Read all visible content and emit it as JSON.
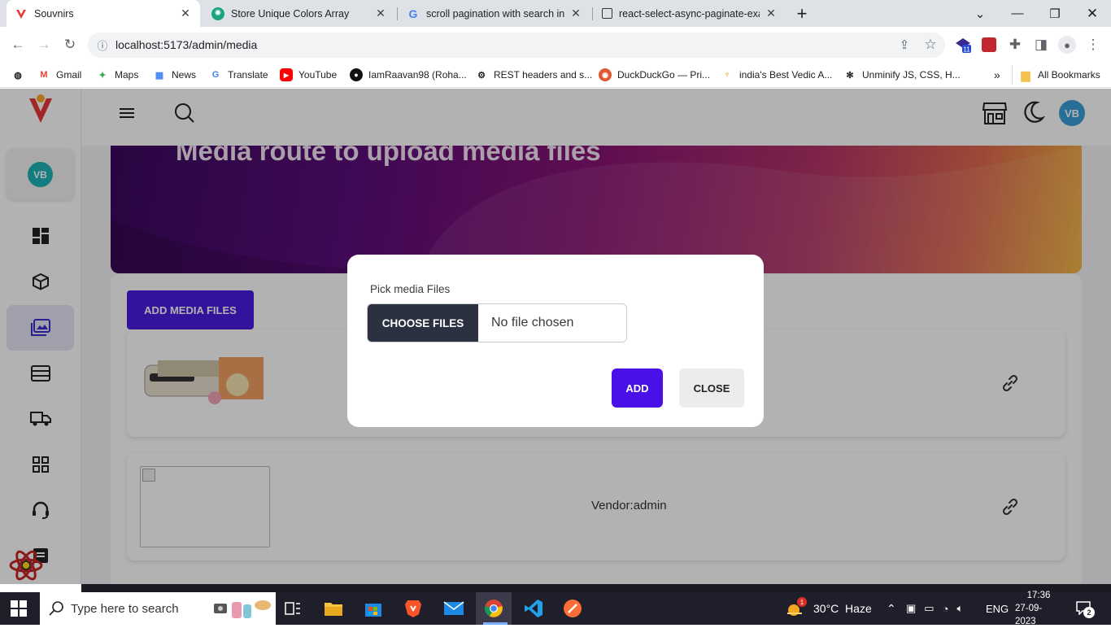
{
  "browser": {
    "tabs": [
      {
        "title": "Souvnirs",
        "active": true
      },
      {
        "title": "Store Unique Colors Array",
        "active": false
      },
      {
        "title": "scroll pagination with search in r",
        "active": false
      },
      {
        "title": "react-select-async-paginate-exa",
        "active": false
      }
    ],
    "new_tab": "+",
    "url": "localhost:5173/admin/media",
    "extension_badge": "11",
    "bookmarks": [
      {
        "label": "Gmail",
        "icon": "gmail-icon"
      },
      {
        "label": "Maps",
        "icon": "maps-icon"
      },
      {
        "label": "News",
        "icon": "news-icon"
      },
      {
        "label": "Translate",
        "icon": "translate-icon"
      },
      {
        "label": "YouTube",
        "icon": "youtube-icon"
      },
      {
        "label": "IamRaavan98 (Roha...",
        "icon": "github-icon"
      },
      {
        "label": "REST headers and s...",
        "icon": "rest-icon"
      },
      {
        "label": "DuckDuckGo — Pri...",
        "icon": "duckduckgo-icon"
      },
      {
        "label": "india's Best Vedic A...",
        "icon": "vedic-icon"
      },
      {
        "label": "Unminify JS, CSS, H...",
        "icon": "unminify-icon"
      }
    ],
    "more_bookmarks": "»",
    "all_bookmarks": "All Bookmarks"
  },
  "app": {
    "avatar_initials": "VB",
    "sidebar_avatar": "VB",
    "banner_title": "Media route to upload media files",
    "add_media_label": "ADD MEDIA FILES",
    "rows": [
      {
        "vendor": "",
        "has_image": true
      },
      {
        "vendor": "Vendor:admin",
        "has_image": false
      }
    ],
    "sidebar_items": [
      "dashboard-icon",
      "box-icon",
      "media-icon",
      "list-icon",
      "truck-icon",
      "apps-icon",
      "headset-icon",
      "inbox-icon"
    ]
  },
  "modal": {
    "label": "Pick media Files",
    "choose_button": "CHOOSE FILES",
    "file_status": "No file chosen",
    "add_button": "ADD",
    "close_button": "CLOSE"
  },
  "taskbar": {
    "search_placeholder": "Type here to search",
    "weather": "30°C  Haze",
    "weather_badge": "1",
    "language": "ENG",
    "time": "17:36",
    "date": "27-09-2023",
    "notifications": "2"
  },
  "colors": {
    "accent": "#4a1ae0",
    "avatar": "#1cb3b8",
    "dark_button": "#2b3140"
  }
}
